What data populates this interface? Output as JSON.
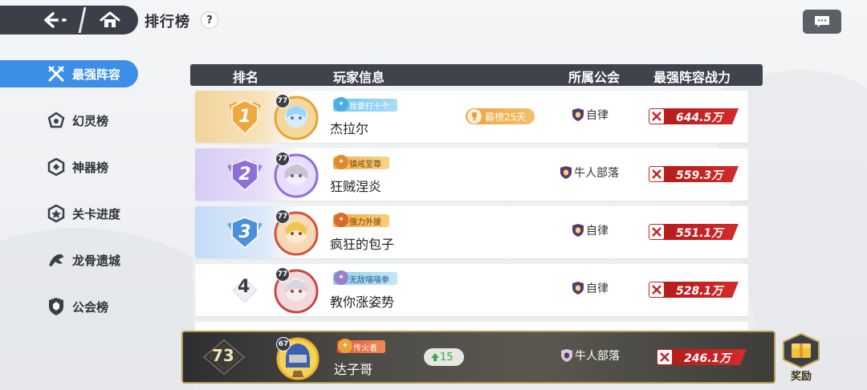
{
  "header": {
    "title": "排行榜",
    "help_label": "?"
  },
  "sidebar": {
    "items": [
      {
        "label": "最强阵容",
        "icon": "crossed-swords-icon",
        "active": true
      },
      {
        "label": "幻灵榜",
        "icon": "spirit-icon",
        "active": false
      },
      {
        "label": "神器榜",
        "icon": "artifact-icon",
        "active": false
      },
      {
        "label": "关卡进度",
        "icon": "stage-star-icon",
        "active": false
      },
      {
        "label": "龙骨遗城",
        "icon": "dragon-icon",
        "active": false
      },
      {
        "label": "公会榜",
        "icon": "guild-shield-icon",
        "active": false
      }
    ]
  },
  "table": {
    "columns": [
      "排名",
      "玩家信息",
      "所属公会",
      "最强阵容战力"
    ],
    "rows": [
      {
        "rank": "1",
        "level": "77",
        "title": "我要打十个",
        "name": "杰拉尔",
        "honor": "霸榜25天",
        "guild": "自律",
        "power": "644.5万"
      },
      {
        "rank": "2",
        "level": "77",
        "title": "镇戒至尊",
        "name": "狂贼涅炎",
        "honor": "",
        "guild": "牛人部落",
        "power": "559.3万"
      },
      {
        "rank": "3",
        "level": "77",
        "title": "强力外援",
        "name": "疯狂的包子",
        "honor": "",
        "guild": "自律",
        "power": "551.1万"
      },
      {
        "rank": "4",
        "level": "77",
        "title": "无敌喵喵拳",
        "name": "教你涨姿势",
        "honor": "",
        "guild": "自律",
        "power": "528.1万"
      }
    ]
  },
  "my_rank": {
    "rank": "73",
    "level": "67",
    "title": "传火者",
    "name": "达子哥",
    "rank_change": "15",
    "guild": "牛人部落",
    "power": "246.1万"
  },
  "reward": {
    "label": "奖励"
  },
  "colors": {
    "accent_blue": "#3d8ee6",
    "header_dark": "#3f434b",
    "power_red": "#c42222",
    "gold": "#e9a341"
  }
}
